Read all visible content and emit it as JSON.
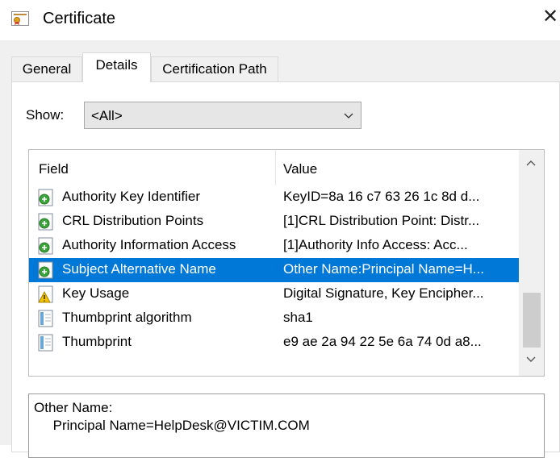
{
  "window": {
    "title": "Certificate",
    "close_glyph": "✕",
    "icon": "certificate-icon"
  },
  "tabs": [
    {
      "label": "General",
      "active": false
    },
    {
      "label": "Details",
      "active": true
    },
    {
      "label": "Certification Path",
      "active": false
    }
  ],
  "show": {
    "label": "Show:",
    "value": "<All>"
  },
  "list": {
    "columns": [
      "Field",
      "Value"
    ],
    "rows": [
      {
        "field": "Authority Key Identifier",
        "value": "KeyID=8a 16 c7 63 26 1c 8d d...",
        "icon": "extension-icon",
        "selected": false
      },
      {
        "field": "CRL Distribution Points",
        "value": "[1]CRL Distribution Point: Distr...",
        "icon": "extension-icon",
        "selected": false
      },
      {
        "field": "Authority Information Access",
        "value": "[1]Authority Info Access: Acc...",
        "icon": "extension-icon",
        "selected": false
      },
      {
        "field": "Subject Alternative Name",
        "value": "Other Name:Principal Name=H...",
        "icon": "extension-icon",
        "selected": true
      },
      {
        "field": "Key Usage",
        "value": "Digital Signature, Key Encipher...",
        "icon": "warning-icon",
        "selected": false
      },
      {
        "field": "Thumbprint algorithm",
        "value": "sha1",
        "icon": "document-icon",
        "selected": false
      },
      {
        "field": "Thumbprint",
        "value": "e9 ae 2a 94 22 5e 6a 74 0d a8...",
        "icon": "document-icon",
        "selected": false
      }
    ]
  },
  "detail": {
    "text": "Other Name:\n     Principal Name=HelpDesk@VICTIM.COM"
  },
  "colors": {
    "selection": "#0078d7",
    "dialog_bg": "#f0f0f0"
  }
}
